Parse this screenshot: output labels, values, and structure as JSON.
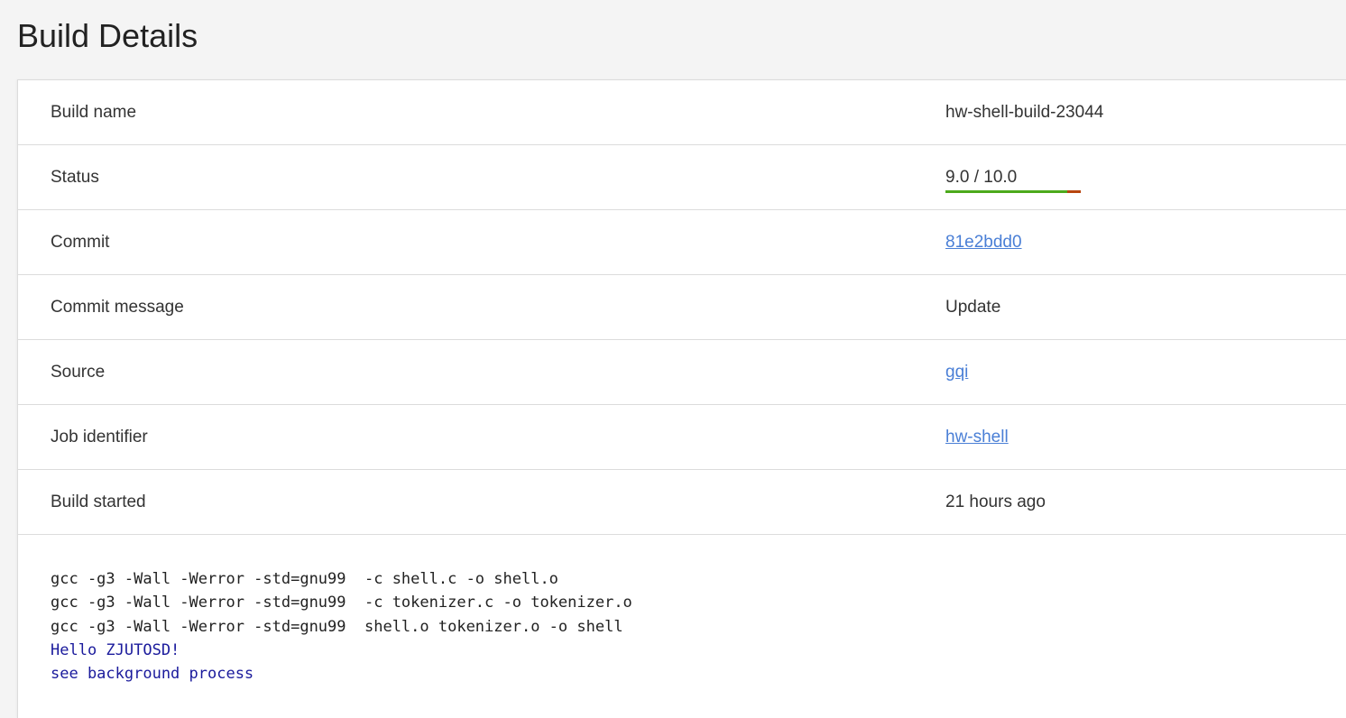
{
  "page": {
    "title": "Build Details"
  },
  "details": {
    "build_name": {
      "label": "Build name",
      "value": "hw-shell-build-23044"
    },
    "status": {
      "label": "Status",
      "value": "9.0 / 10.0",
      "score": 9.0,
      "max": 10.0,
      "pass_color": "#4caa1c",
      "fail_color": "#b8450f"
    },
    "commit": {
      "label": "Commit",
      "value": "81e2bdd0"
    },
    "commit_message": {
      "label": "Commit message",
      "value": "Update"
    },
    "source": {
      "label": "Source",
      "value": "gqi"
    },
    "job_identifier": {
      "label": "Job identifier",
      "value": "hw-shell"
    },
    "build_started": {
      "label": "Build started",
      "value": "21 hours ago"
    }
  },
  "log": {
    "lines": [
      {
        "text": "gcc -g3 -Wall -Werror -std=gnu99  -c shell.c -o shell.o",
        "kind": "command"
      },
      {
        "text": "gcc -g3 -Wall -Werror -std=gnu99  -c tokenizer.c -o tokenizer.o",
        "kind": "command"
      },
      {
        "text": "gcc -g3 -Wall -Werror -std=gnu99  shell.o tokenizer.o -o shell",
        "kind": "command"
      },
      {
        "text": "Hello ZJUTOSD!",
        "kind": "output"
      },
      {
        "text": "see background process",
        "kind": "output"
      }
    ],
    "colors": {
      "command": "#222222",
      "output": "#1a1a9c"
    }
  }
}
